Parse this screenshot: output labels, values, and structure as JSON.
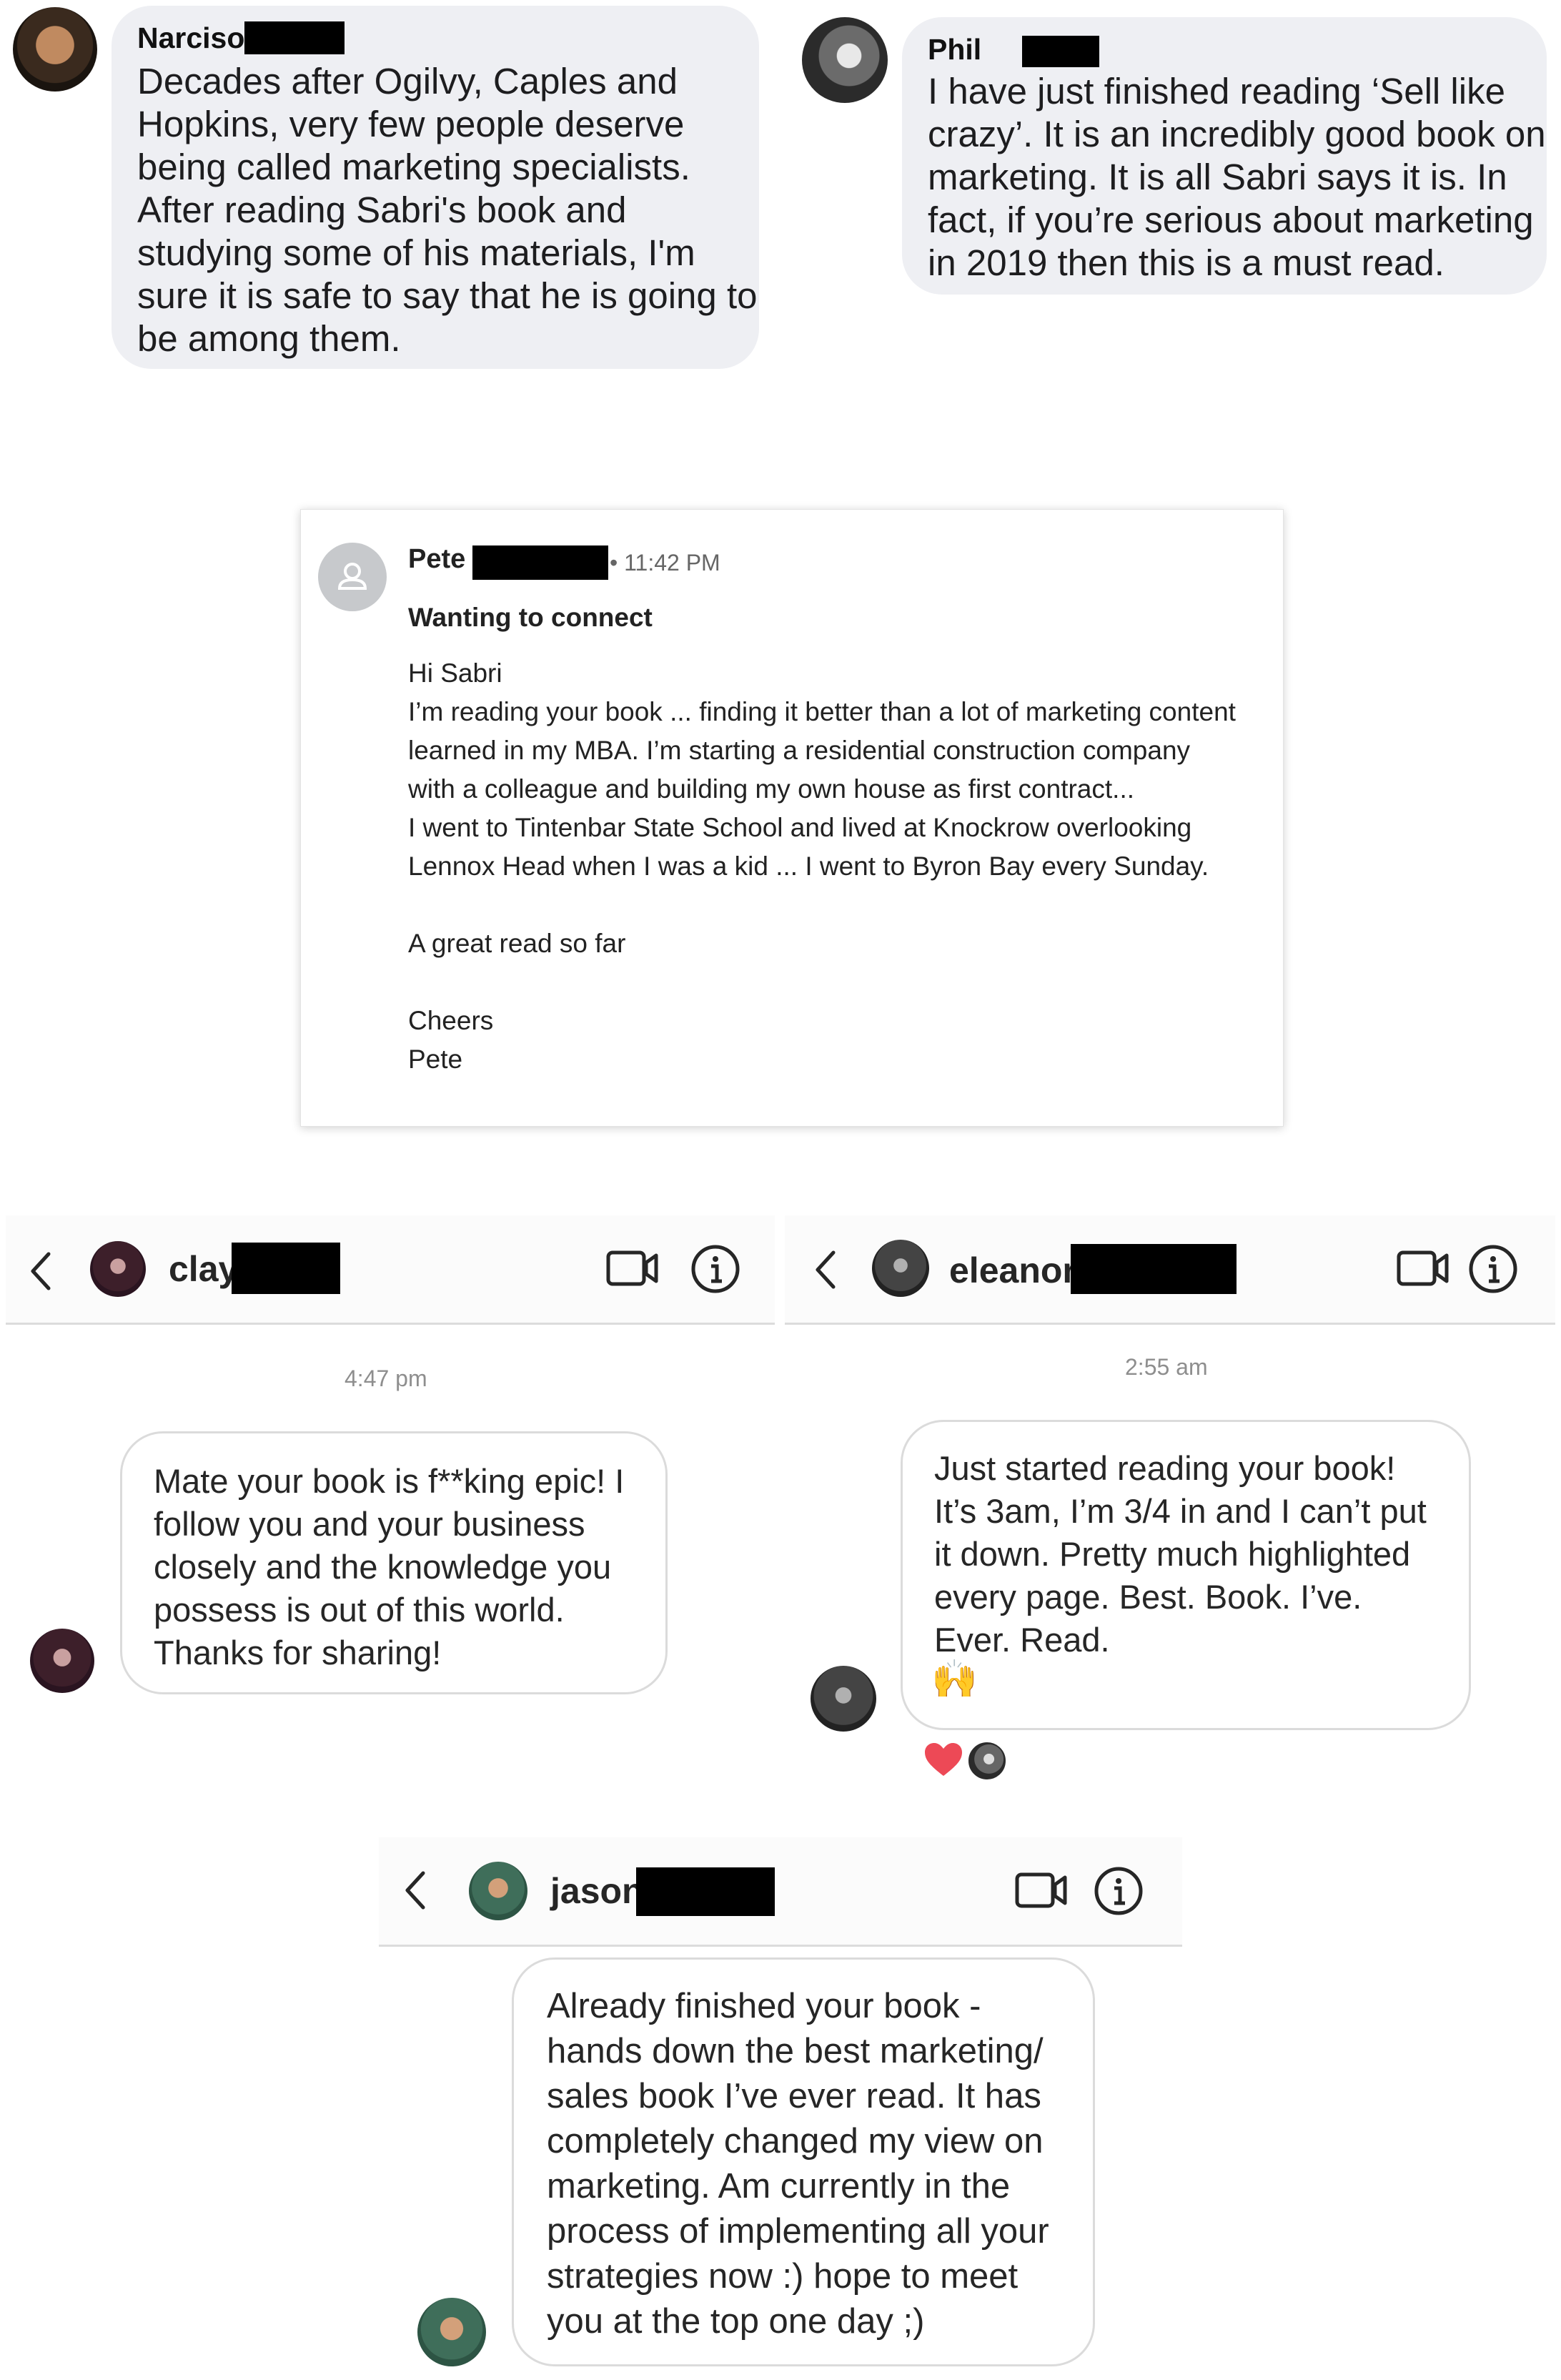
{
  "narciso": {
    "name": "Narciso",
    "lines": [
      "Decades after Ogilvy, Caples and",
      "Hopkins, very few people deserve",
      "being called marketing specialists.",
      "After reading Sabri's book and",
      "studying some of his materials, I'm",
      "sure it is safe to say that he is going to",
      "be among them."
    ]
  },
  "phil": {
    "name": "Phil",
    "lines": [
      "I have just finished reading ‘Sell like",
      "crazy’. It is an incredibly good book on",
      "marketing. It is all Sabri says it is. In",
      "fact, if you’re serious about marketing",
      "in 2019 then this is a must read."
    ]
  },
  "pete": {
    "name": "Pete",
    "time": "• 11:42 PM",
    "subject": "Wanting to connect",
    "lines": [
      "Hi Sabri",
      "I’m reading your book ... finding it better than a lot of marketing content",
      "learned in my MBA. I’m starting a residential construction company",
      "with a colleague and building my own house as first contract...",
      "I went to Tintenbar State School and lived at Knockrow overlooking",
      "Lennox Head when I was a kid ... I went to Byron Bay every Sunday.",
      "A great read so far",
      "Cheers",
      "Pete"
    ]
  },
  "clay": {
    "name": "clay",
    "time": "4:47 pm",
    "lines": [
      "Mate your book is f**king epic! I",
      "follow you and your business",
      "closely and the knowledge you",
      "possess is out of this world.",
      "Thanks for sharing!"
    ]
  },
  "eleanor": {
    "name": "eleanor",
    "time": "2:55 am",
    "lines": [
      "Just started reading your book!",
      "It’s 3am, I’m 3/4 in and I can’t put",
      "it down. Pretty much highlighted",
      "every page. Best. Book. I’ve.",
      "Ever. Read."
    ],
    "emoji": "🙌"
  },
  "jason": {
    "name": "jason",
    "lines": [
      "Already finished your book -",
      "hands down the best marketing/",
      "sales book I’ve ever read. It has",
      "completely changed my view on",
      "marketing. Am currently in the",
      "process of implementing all your",
      "strategies now :) hope to meet",
      "you at the top one day ;)"
    ]
  },
  "colors": {
    "bubble_gray": "#eeeff3",
    "reaction_heart": "#ed4956",
    "border": "#dbdbdb"
  }
}
